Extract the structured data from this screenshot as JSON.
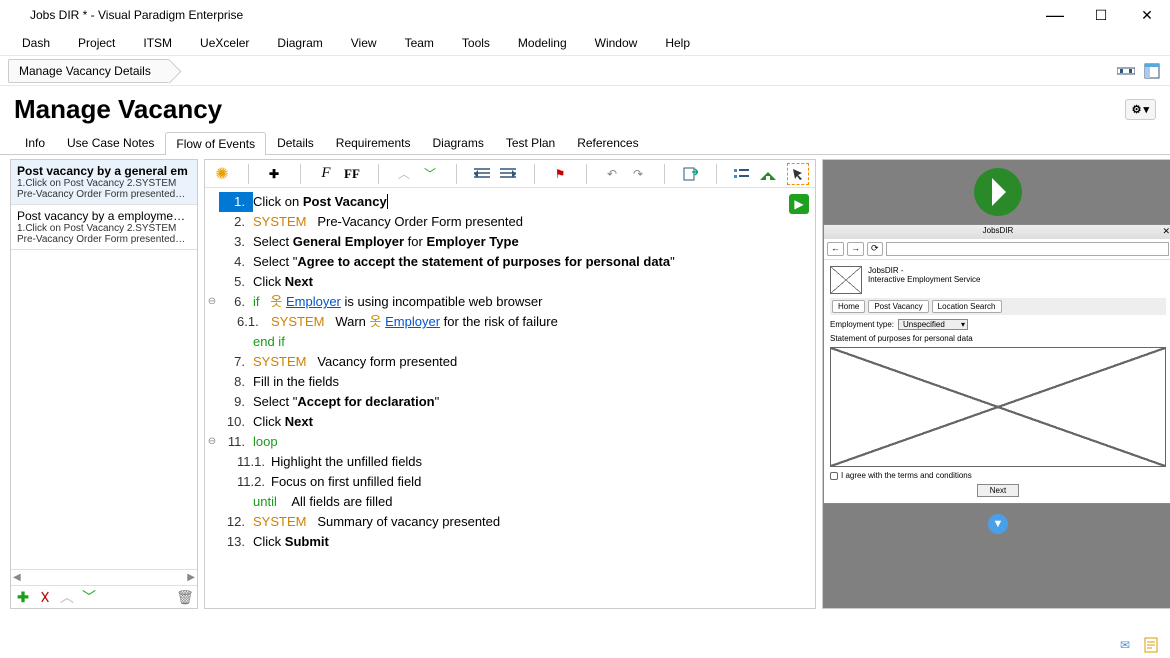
{
  "window": {
    "title": "Jobs DIR * - Visual Paradigm Enterprise"
  },
  "menu": {
    "items": [
      "Dash",
      "Project",
      "ITSM",
      "UeXceler",
      "Diagram",
      "View",
      "Team",
      "Tools",
      "Modeling",
      "Window",
      "Help"
    ]
  },
  "breadcrumb": {
    "label": "Manage Vacancy Details"
  },
  "page": {
    "title": "Manage Vacancy"
  },
  "tabs": {
    "items": [
      "Info",
      "Use Case Notes",
      "Flow of Events",
      "Details",
      "Requirements",
      "Diagrams",
      "Test Plan",
      "References"
    ],
    "active": 2
  },
  "scenarios": [
    {
      "title": "Post vacancy by a general em",
      "lines": [
        "1.Click on Post Vacancy 2.SYSTEM",
        "Pre-Vacancy Order Form presented…"
      ],
      "active": true
    },
    {
      "title": "Post vacancy by a employment ager",
      "lines": [
        "1.Click on Post Vacancy 2.SYSTEM",
        "Pre-Vacancy Order Form presented…"
      ],
      "active": false
    }
  ],
  "flow": {
    "1": {
      "num": "1.",
      "text_pre": "Click on ",
      "bold": "Post Vacancy"
    },
    "2": {
      "num": "2.",
      "system": "SYSTEM",
      "text": "Pre-Vacancy Order Form presented"
    },
    "3": {
      "num": "3.",
      "text_pre": "Select ",
      "bold": "General Employer",
      "mid": " for ",
      "bold2": "Employer Type"
    },
    "4": {
      "num": "4.",
      "text_pre": "Select \"",
      "bold": "Agree to accept the statement of purposes for personal data",
      "post": "\""
    },
    "5": {
      "num": "5.",
      "text_pre": "Click ",
      "bold": "Next"
    },
    "6": {
      "num": "6.",
      "if": "if",
      "actor": "Employer",
      "text": " is using incompatible web browser"
    },
    "6_1": {
      "num": "6.1.",
      "system": "SYSTEM",
      "text_pre": "Warn ",
      "actor": "Employer",
      "text": " for the risk of failure"
    },
    "6e": {
      "endif": "end if"
    },
    "7": {
      "num": "7.",
      "system": "SYSTEM",
      "text": "Vacancy form presented"
    },
    "8": {
      "num": "8.",
      "text": "Fill in the fields"
    },
    "9": {
      "num": "9.",
      "text_pre": "Select \"",
      "bold": "Accept for declaration",
      "post": "\""
    },
    "10": {
      "num": "10.",
      "text_pre": "Click ",
      "bold": "Next"
    },
    "11": {
      "num": "11.",
      "loop": "loop"
    },
    "11_1": {
      "num": "11.1.",
      "text": "Highlight the unfilled fields"
    },
    "11_2": {
      "num": "11.2.",
      "text": "Focus on first unfilled field"
    },
    "11u": {
      "until": "until",
      "text": "All fields are filled"
    },
    "12": {
      "num": "12.",
      "system": "SYSTEM",
      "text": "Summary of vacancy presented"
    },
    "13": {
      "num": "13.",
      "text_pre": "Click ",
      "bold": "Submit"
    }
  },
  "wireframe": {
    "window_title": "JobsDIR",
    "hdr1": "JobsDIR -",
    "hdr2": "Interactive Employment Service",
    "tabs": [
      "Home",
      "Post Vacancy",
      "Location Search"
    ],
    "emp_label": "Employment type:",
    "emp_value": "Unspecified",
    "stmt": "Statement of purposes for personal data",
    "check": "I agree with the terms and conditions",
    "next": "Next",
    "nav_back": "←",
    "nav_fwd": "→",
    "nav_reload": "⟳"
  }
}
